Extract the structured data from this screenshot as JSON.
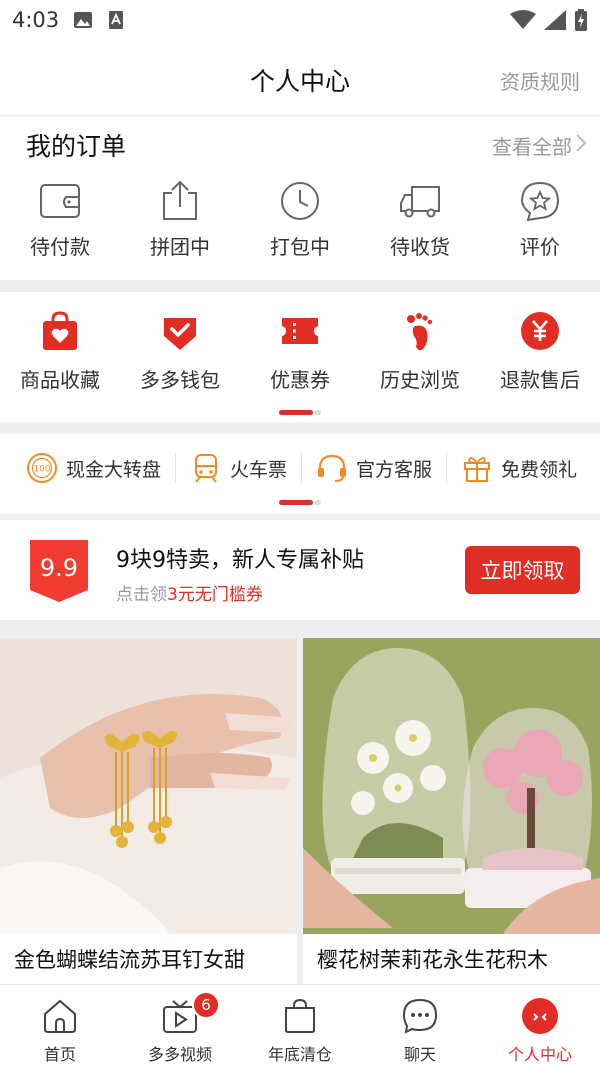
{
  "status_bar": {
    "time": "4:03"
  },
  "header": {
    "title": "个人中心",
    "rules_link": "资质规则"
  },
  "orders": {
    "title": "我的订单",
    "see_all": "查看全部",
    "items": [
      {
        "label": "待付款",
        "icon": "wallet-icon"
      },
      {
        "label": "拼团中",
        "icon": "share-icon"
      },
      {
        "label": "打包中",
        "icon": "clock-icon"
      },
      {
        "label": "待收货",
        "icon": "truck-icon"
      },
      {
        "label": "评价",
        "icon": "star-badge-icon"
      }
    ]
  },
  "services": {
    "items": [
      {
        "label": "商品收藏",
        "icon": "favorite-bag-icon"
      },
      {
        "label": "多多钱包",
        "icon": "wallet-heart-icon"
      },
      {
        "label": "优惠券",
        "icon": "coupon-icon"
      },
      {
        "label": "历史浏览",
        "icon": "footprint-icon"
      },
      {
        "label": "退款售后",
        "icon": "refund-icon"
      }
    ]
  },
  "tools": {
    "items": [
      {
        "label": "现金大转盘",
        "icon": "spin-wheel-icon"
      },
      {
        "label": "火车票",
        "icon": "train-icon"
      },
      {
        "label": "官方客服",
        "icon": "headset-icon"
      },
      {
        "label": "免费领礼",
        "icon": "gift-icon"
      }
    ]
  },
  "promo": {
    "badge": "9.9",
    "title": "9块9特卖，新人专属补贴",
    "subtitle_prefix": "点击领",
    "subtitle_highlight": "3元无门槛券",
    "button": "立即领取"
  },
  "products": [
    {
      "name": "金色蝴蝶结流苏耳钉女甜"
    },
    {
      "name": "樱花树茉莉花永生花积木"
    }
  ],
  "tabbar": {
    "items": [
      {
        "label": "首页",
        "icon": "home-icon"
      },
      {
        "label": "多多视频",
        "icon": "video-icon",
        "badge": "6"
      },
      {
        "label": "年底清仓",
        "icon": "shopping-bag-icon"
      },
      {
        "label": "聊天",
        "icon": "chat-icon"
      },
      {
        "label": "个人中心",
        "icon": "profile-icon",
        "active": true
      }
    ]
  },
  "colors": {
    "accent": "#e02e24",
    "muted": "#999999"
  }
}
